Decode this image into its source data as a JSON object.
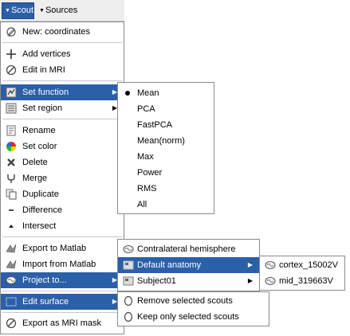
{
  "toolbar": {
    "scout_tab": "Scout",
    "sources_tab": "Sources"
  },
  "main_menu": {
    "new_coordinates": "New: coordinates",
    "add_vertices": "Add vertices",
    "edit_in_mri": "Edit in MRI",
    "set_function": "Set function",
    "set_region": "Set region",
    "rename": "Rename",
    "set_color": "Set color",
    "delete": "Delete",
    "merge": "Merge",
    "duplicate": "Duplicate",
    "difference": "Difference",
    "intersect": "Intersect",
    "export_to_matlab": "Export to Matlab",
    "import_from_matlab": "Import from Matlab",
    "project_to": "Project to...",
    "edit_surface": "Edit surface",
    "export_as_mri_mask": "Export as MRI mask"
  },
  "function_menu": {
    "selected": "Mean",
    "items": [
      "Mean",
      "PCA",
      "FastPCA",
      "Mean(norm)",
      "Max",
      "Power",
      "RMS",
      "All"
    ]
  },
  "project_menu": {
    "contralateral": "Contralateral hemisphere",
    "default_anatomy": "Default anatomy",
    "subject": "Subject01"
  },
  "anatomy_menu": {
    "items": [
      "cortex_15002V",
      "mid_319663V"
    ]
  },
  "surface_menu": {
    "remove_selected": "Remove selected scouts",
    "keep_only_selected": "Keep only selected scouts"
  },
  "colors": {
    "highlight": "#2b5fa8",
    "menu_border": "#8b8b8b",
    "separator": "#c8c8c8"
  }
}
